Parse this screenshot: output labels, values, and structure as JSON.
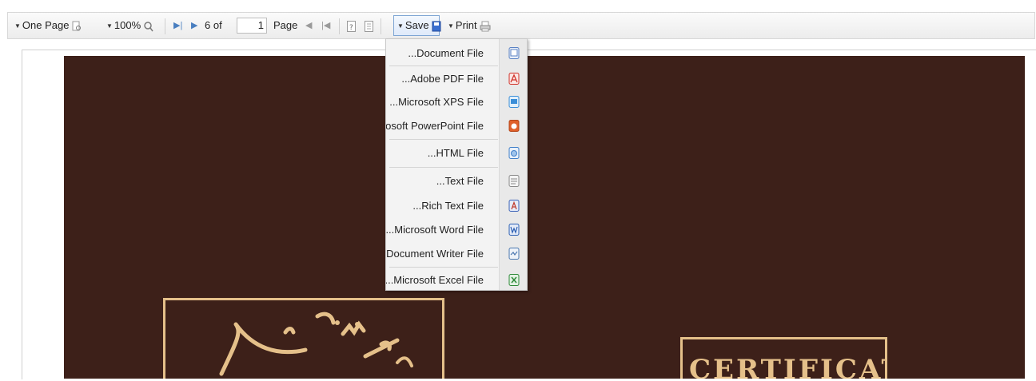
{
  "toolbar": {
    "one_page": "One Page",
    "zoom": "100%",
    "page_of": "6 of",
    "page_value": "1",
    "page_label": "Page",
    "save": "Save",
    "print": "Print"
  },
  "save_menu": {
    "items": [
      {
        "label": "...Document File",
        "icon": "document-file-icon",
        "color": "#5a82c4"
      },
      {
        "label": "...Adobe PDF File",
        "icon": "pdf-file-icon",
        "color": "#d0332a"
      },
      {
        "label": "...Microsoft XPS File",
        "icon": "xps-file-icon",
        "color": "#3a8ed8"
      },
      {
        "label": "...Microsoft PowerPoint File",
        "icon": "powerpoint-file-icon",
        "color": "#e0602a"
      },
      {
        "label": "...HTML File",
        "icon": "html-file-icon",
        "color": "#3f7fc9"
      },
      {
        "label": "...Text File",
        "icon": "text-file-icon",
        "color": "#8a8a8a"
      },
      {
        "label": "...Rich Text File",
        "icon": "rich-text-file-icon",
        "color": "#3a62b8"
      },
      {
        "label": "...Microsoft Word File",
        "icon": "word-file-icon",
        "color": "#2b5fb3"
      },
      {
        "label": "...OpenDocument Writer File",
        "icon": "odt-file-icon",
        "color": "#4b78b0"
      },
      {
        "label": "...Microsoft Excel File",
        "icon": "excel-file-icon",
        "color": "#2f8a3a"
      }
    ]
  },
  "certificate": {
    "heading": "CERTIFICATE",
    "background": "#3d2019",
    "accent": "#e5c08a"
  }
}
